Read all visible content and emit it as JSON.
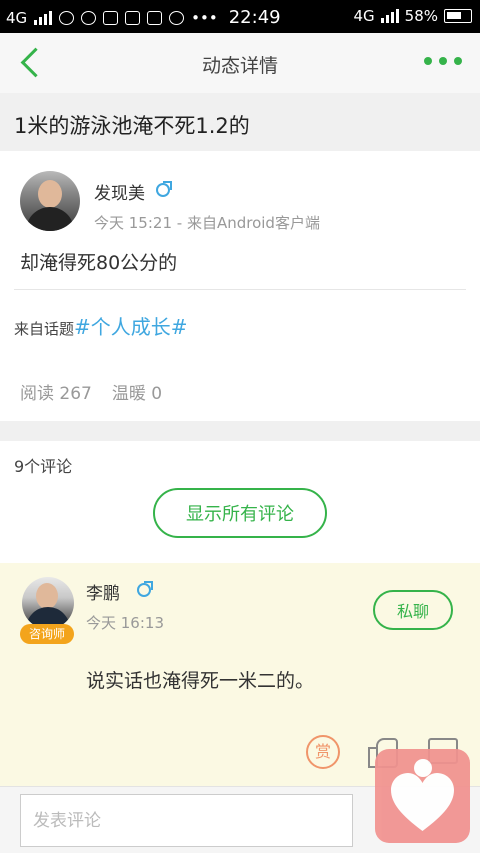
{
  "status_bar": {
    "network_left": "4G",
    "time": "22:49",
    "network_right": "4G",
    "battery": "58%"
  },
  "nav": {
    "title": "动态详情"
  },
  "post": {
    "title": "1米的游泳池淹不死1.2的",
    "author": "发现美",
    "meta": "今天 15:21 - 来自Android客户端",
    "body": "却淹得死80公分的",
    "topic_prefix": "来自话题",
    "topic": "#个人成长#",
    "reads": "阅读 267",
    "warmth": "温暖 0"
  },
  "comments": {
    "count_label": "9个评论",
    "show_all_label": "显示所有评论",
    "items": [
      {
        "name": "李鹏",
        "badge": "咨询师",
        "meta": "今天 16:13",
        "private_label": "私聊",
        "body": "说实话也淹得死一米二的。",
        "reward_label": "赏"
      }
    ]
  },
  "input": {
    "placeholder": "发表评论"
  },
  "colors": {
    "accent": "#35b34a",
    "topic": "#3fa7e0",
    "badge": "#f3a41c",
    "comment_bg": "#fbf9e3",
    "heart_bg": "#f1928f"
  }
}
